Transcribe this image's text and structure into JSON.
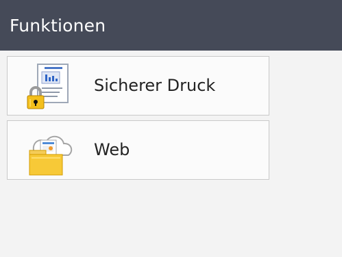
{
  "header": {
    "title": "Funktionen"
  },
  "menu": {
    "items": [
      {
        "label": "Sicherer Druck",
        "icon": "secure-print-icon"
      },
      {
        "label": "Web",
        "icon": "web-folder-icon"
      }
    ]
  },
  "colors": {
    "header_background": "#454a58",
    "page_background": "#f3f3f3",
    "item_background": "#fbfbfb",
    "text": "#232323"
  }
}
